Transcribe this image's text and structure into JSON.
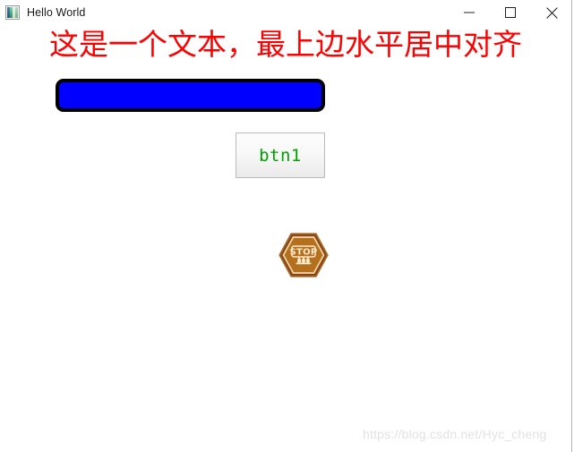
{
  "window": {
    "title": "Hello World",
    "icon_name": "app-gradient-bars-icon",
    "controls": {
      "minimize_label": "Minimize",
      "maximize_label": "Maximize",
      "close_label": "Close"
    }
  },
  "content": {
    "heading": {
      "text": "这是一个文本，最上边水平居中对齐",
      "color": "#ff0000"
    },
    "blue_rect": {
      "fill_color": "#0000ff",
      "border_color": "#000000",
      "label": ""
    },
    "button": {
      "label": "btn1",
      "text_color": "#00a000"
    },
    "stop_icon": {
      "name": "stop-sign-icon",
      "text": "STOP",
      "outer_color": "#8c4a14",
      "inner_color": "#b9701f",
      "accent_color": "#ffe9c9"
    }
  },
  "watermark": {
    "text": "https://blog.csdn.net/Hyc_cheng",
    "color": "#e2e2e2"
  }
}
